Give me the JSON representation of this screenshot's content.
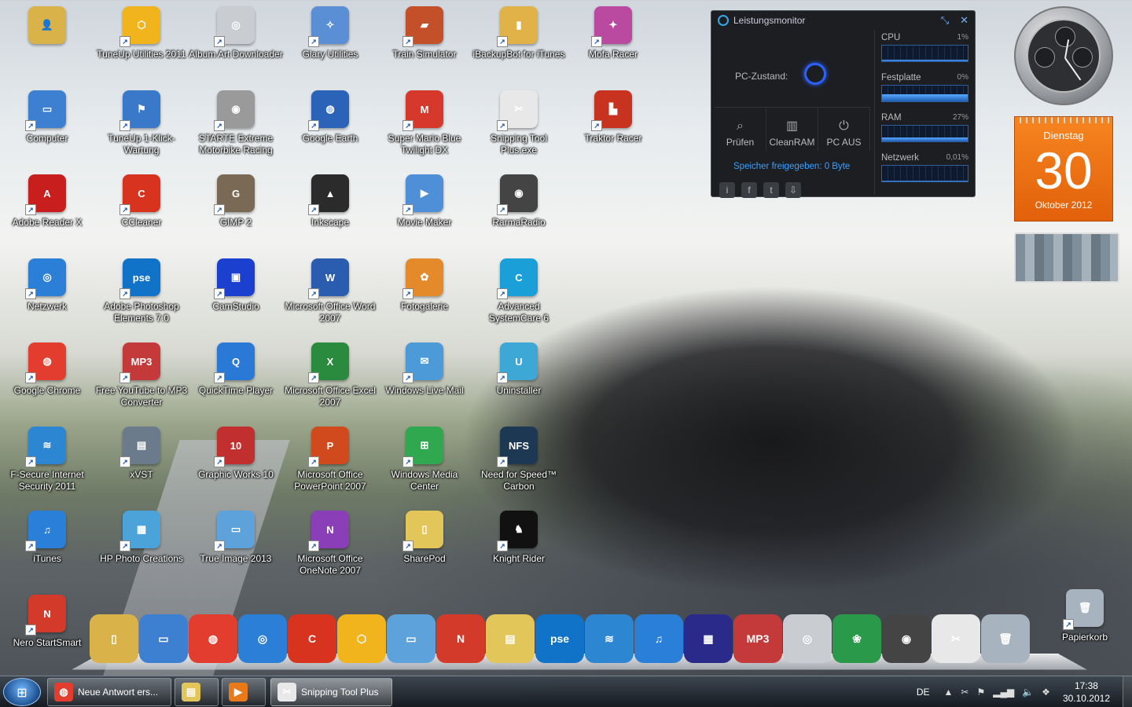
{
  "desktop_icons": [
    {
      "label": "",
      "color": "#d9b34a",
      "glyph": "👤",
      "col": 0,
      "row": 0
    },
    {
      "label": "TuneUp Utilities 2011",
      "color": "#f2b41c",
      "glyph": "⬡",
      "col": 1,
      "row": 0
    },
    {
      "label": "Album Art Downloader",
      "color": "#c9ccd1",
      "glyph": "◎",
      "col": 2,
      "row": 0
    },
    {
      "label": "Glary Utilities",
      "color": "#5a8fd6",
      "glyph": "✧",
      "col": 3,
      "row": 0
    },
    {
      "label": "Train Simulator",
      "color": "#c4502a",
      "glyph": "▰",
      "col": 4,
      "row": 0
    },
    {
      "label": "iBackupBot for iTunes",
      "color": "#e1b247",
      "glyph": "▮",
      "col": 5,
      "row": 0
    },
    {
      "label": "Mofa Racer",
      "color": "#b94aa0",
      "glyph": "✦",
      "col": 6,
      "row": 0
    },
    {
      "label": "Computer",
      "color": "#3d7fd1",
      "glyph": "▭",
      "col": 0,
      "row": 1
    },
    {
      "label": "TuneUp 1-Klick-Wartung",
      "color": "#3a78c9",
      "glyph": "⚑",
      "col": 1,
      "row": 1
    },
    {
      "label": "STARTE Extreme Motorbike Racing",
      "color": "#9a9a9a",
      "glyph": "◉",
      "col": 2,
      "row": 1
    },
    {
      "label": "Google Earth",
      "color": "#2a63b8",
      "glyph": "◍",
      "col": 3,
      "row": 1
    },
    {
      "label": "Super Mario Blue Twilight DX",
      "color": "#d6392b",
      "glyph": "M",
      "col": 4,
      "row": 1
    },
    {
      "label": "Snipping Tool Plus.exe",
      "color": "#e8e8e8",
      "glyph": "✂",
      "col": 5,
      "row": 1
    },
    {
      "label": "Traktor Racer",
      "color": "#c8331f",
      "glyph": "▙",
      "col": 6,
      "row": 1
    },
    {
      "label": "Adobe Reader X",
      "color": "#c81e1e",
      "glyph": "A",
      "col": 0,
      "row": 2
    },
    {
      "label": "CCleaner",
      "color": "#d8331f",
      "glyph": "C",
      "col": 1,
      "row": 2
    },
    {
      "label": "GIMP 2",
      "color": "#7a6a55",
      "glyph": "G",
      "col": 2,
      "row": 2
    },
    {
      "label": "Inkscape",
      "color": "#2b2b2b",
      "glyph": "▲",
      "col": 3,
      "row": 2
    },
    {
      "label": "Movie Maker",
      "color": "#4f8fd8",
      "glyph": "▶",
      "col": 4,
      "row": 2
    },
    {
      "label": "RarmaRadio",
      "color": "#444",
      "glyph": "◉",
      "col": 5,
      "row": 2
    },
    {
      "label": "Netzwerk",
      "color": "#2c7fd6",
      "glyph": "◎",
      "col": 0,
      "row": 3
    },
    {
      "label": "Adobe Photoshop Elements 7.0",
      "color": "#1173c7",
      "glyph": "pse",
      "col": 1,
      "row": 3
    },
    {
      "label": "CamStudio",
      "color": "#1b40d0",
      "glyph": "▣",
      "col": 2,
      "row": 3
    },
    {
      "label": "Microsoft Office Word 2007",
      "color": "#2a5db0",
      "glyph": "W",
      "col": 3,
      "row": 3
    },
    {
      "label": "Fotogalerie",
      "color": "#e48a2a",
      "glyph": "✿",
      "col": 4,
      "row": 3
    },
    {
      "label": "Advanced SystemCare 6",
      "color": "#1a9fd8",
      "glyph": "C",
      "col": 5,
      "row": 3
    },
    {
      "label": "Google Chrome",
      "color": "#e23d2e",
      "glyph": "◍",
      "col": 0,
      "row": 4
    },
    {
      "label": "Free YouTube to MP3 Converter",
      "color": "#c43a3a",
      "glyph": "MP3",
      "col": 1,
      "row": 4
    },
    {
      "label": "QuickTime Player",
      "color": "#2a79d6",
      "glyph": "Q",
      "col": 2,
      "row": 4
    },
    {
      "label": "Microsoft Office Excel 2007",
      "color": "#2a8a3d",
      "glyph": "X",
      "col": 3,
      "row": 4
    },
    {
      "label": "Windows Live Mail",
      "color": "#4d9ad8",
      "glyph": "✉",
      "col": 4,
      "row": 4
    },
    {
      "label": "Uninstaller",
      "color": "#3da7d6",
      "glyph": "U",
      "col": 5,
      "row": 4
    },
    {
      "label": "F-Secure Internet Security 2011",
      "color": "#2c86d2",
      "glyph": "≋",
      "col": 0,
      "row": 5
    },
    {
      "label": "xVST",
      "color": "#6b7b8b",
      "glyph": "▤",
      "col": 1,
      "row": 5
    },
    {
      "label": "Graphic Works 10",
      "color": "#c22f2f",
      "glyph": "10",
      "col": 2,
      "row": 5
    },
    {
      "label": "Microsoft Office PowerPoint 2007",
      "color": "#d04a1e",
      "glyph": "P",
      "col": 3,
      "row": 5
    },
    {
      "label": "Windows Media Center",
      "color": "#2fa84f",
      "glyph": "⊞",
      "col": 4,
      "row": 5
    },
    {
      "label": "Need for Speed™ Carbon",
      "color": "#1c3852",
      "glyph": "NFS",
      "col": 5,
      "row": 5
    },
    {
      "label": "iTunes",
      "color": "#2a7fd8",
      "glyph": "♫",
      "col": 0,
      "row": 6
    },
    {
      "label": "HP Photo Creations",
      "color": "#4ba3d9",
      "glyph": "▦",
      "col": 1,
      "row": 6
    },
    {
      "label": "True Image 2013",
      "color": "#5ea2dc",
      "glyph": "▭",
      "col": 2,
      "row": 6
    },
    {
      "label": "Microsoft Office OneNote 2007",
      "color": "#8a3fb8",
      "glyph": "N",
      "col": 3,
      "row": 6
    },
    {
      "label": "SharePod",
      "color": "#e3c65a",
      "glyph": "▯",
      "col": 4,
      "row": 6
    },
    {
      "label": "Knight Rider",
      "color": "#111",
      "glyph": "♞",
      "col": 5,
      "row": 6
    },
    {
      "label": "Nero StartSmart",
      "color": "#d43a2a",
      "glyph": "N",
      "col": 0,
      "row": 7
    },
    {
      "label": "Papierkorb",
      "color": "#a7b4c0",
      "glyph": "🗑",
      "col": 11,
      "row": 7
    }
  ],
  "perfmon": {
    "title": "Leistungsmonitor",
    "state_label": "PC-Zustand:",
    "buttons": [
      {
        "label": "Prüfen",
        "glyph": "⌕"
      },
      {
        "label": "CleanRAM",
        "glyph": "▥"
      },
      {
        "label": "PC AUS",
        "glyph": "⏻"
      }
    ],
    "freed": "Speicher freigegeben: 0 Byte",
    "meters": [
      {
        "label": "CPU",
        "value": "1%",
        "level": 0.08
      },
      {
        "label": "Festplatte",
        "value": "0%",
        "level": 0.45
      },
      {
        "label": "RAM",
        "value": "27%",
        "level": 0.27
      },
      {
        "label": "Netzwerk",
        "value": "0,01%",
        "level": 0.05
      }
    ],
    "social": [
      "i",
      "f",
      "t",
      "⇩"
    ]
  },
  "calendar": {
    "weekday": "Dienstag",
    "day": "30",
    "month": "Oktober 2012"
  },
  "dock_items": [
    {
      "name": "user-folder",
      "color": "#d9b34a",
      "glyph": "▯"
    },
    {
      "name": "computer",
      "color": "#3d7fd1",
      "glyph": "▭"
    },
    {
      "name": "chrome",
      "color": "#e23d2e",
      "glyph": "◍"
    },
    {
      "name": "network",
      "color": "#2c7fd6",
      "glyph": "◎"
    },
    {
      "name": "ccleaner",
      "color": "#d8331f",
      "glyph": "C"
    },
    {
      "name": "tuneup",
      "color": "#f2b41c",
      "glyph": "⬡"
    },
    {
      "name": "true-image",
      "color": "#5ea2dc",
      "glyph": "▭"
    },
    {
      "name": "nero",
      "color": "#d43a2a",
      "glyph": "N"
    },
    {
      "name": "explorer",
      "color": "#e3c65a",
      "glyph": "▤"
    },
    {
      "name": "photoshop-elements",
      "color": "#1173c7",
      "glyph": "pse"
    },
    {
      "name": "f-secure",
      "color": "#2c86d2",
      "glyph": "≋"
    },
    {
      "name": "itunes",
      "color": "#2a7fd8",
      "glyph": "♫"
    },
    {
      "name": "movie-maker",
      "color": "#2a2a8a",
      "glyph": "▦"
    },
    {
      "name": "mp3-converter",
      "color": "#c43a3a",
      "glyph": "MP3"
    },
    {
      "name": "album-art",
      "color": "#c9ccd1",
      "glyph": "◎"
    },
    {
      "name": "msn",
      "color": "#2a9a4a",
      "glyph": "❀"
    },
    {
      "name": "rarmaradio",
      "color": "#444",
      "glyph": "◉"
    },
    {
      "name": "snipping-tool",
      "color": "#e8e8e8",
      "glyph": "✂"
    },
    {
      "name": "recycle-bin",
      "color": "#a7b4c0",
      "glyph": "🗑"
    }
  ],
  "taskbar": {
    "tasks": [
      {
        "label": "Neue Antwort ers...",
        "color": "#e23d2e",
        "glyph": "◍",
        "active": false
      },
      {
        "label": "",
        "color": "#e3c65a",
        "glyph": "▤",
        "active": false
      },
      {
        "label": "",
        "color": "#e87a1a",
        "glyph": "▶",
        "active": false
      },
      {
        "label": "Snipping Tool Plus",
        "color": "#e8e8e8",
        "glyph": "✂",
        "active": true
      }
    ],
    "lang": "DE",
    "time": "17:38",
    "date": "30.10.2012"
  }
}
